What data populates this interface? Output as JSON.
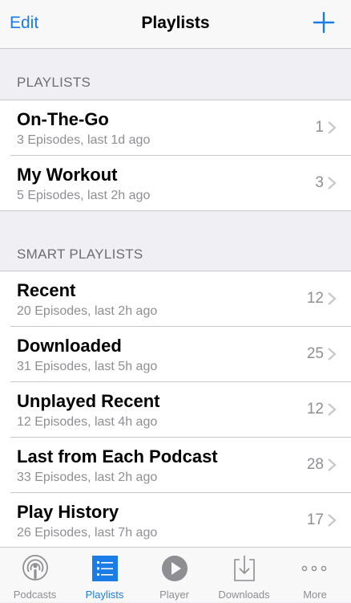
{
  "navbar": {
    "edit_label": "Edit",
    "title": "Playlists",
    "add_icon": "plus-icon"
  },
  "sections": [
    {
      "header": "PLAYLISTS",
      "rows": [
        {
          "title": "On-The-Go",
          "subtitle": "3 Episodes, last 1d ago",
          "count": "1"
        },
        {
          "title": "My Workout",
          "subtitle": "5 Episodes, last 2h ago",
          "count": "3"
        }
      ]
    },
    {
      "header": "SMART PLAYLISTS",
      "rows": [
        {
          "title": "Recent",
          "subtitle": "20 Episodes, last 2h ago",
          "count": "12"
        },
        {
          "title": "Downloaded",
          "subtitle": "31 Episodes, last 5h ago",
          "count": "25"
        },
        {
          "title": "Unplayed Recent",
          "subtitle": "12 Episodes, last 4h ago",
          "count": "12"
        },
        {
          "title": "Last from Each Podcast",
          "subtitle": "33 Episodes, last 2h ago",
          "count": "28"
        },
        {
          "title": "Play History",
          "subtitle": "26 Episodes, last 7h ago",
          "count": "17"
        }
      ]
    }
  ],
  "tabbar": {
    "tabs": [
      {
        "label": "Podcasts",
        "icon": "podcast-icon"
      },
      {
        "label": "Playlists",
        "icon": "list-icon",
        "active": true
      },
      {
        "label": "Player",
        "icon": "play-icon"
      },
      {
        "label": "Downloads",
        "icon": "download-icon"
      },
      {
        "label": "More",
        "icon": "more-icon"
      }
    ]
  },
  "colors": {
    "accent": "#1a7ce6",
    "secondary_text": "#8e8e93",
    "background": "#efeff4"
  }
}
